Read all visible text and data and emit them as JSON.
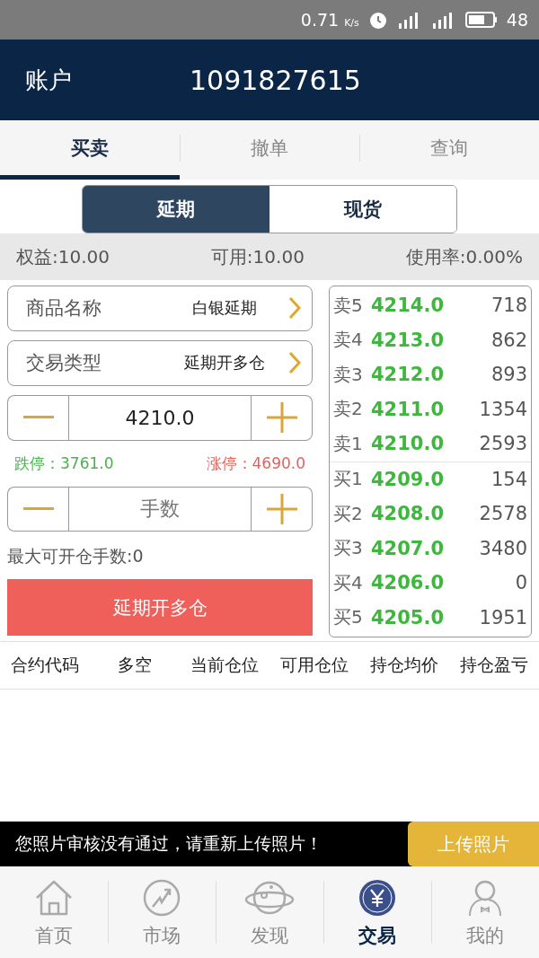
{
  "status_bar": {
    "speed": "0.71",
    "speed_unit": "K/s",
    "battery": "48"
  },
  "header": {
    "title": "账户",
    "account": "1091827615"
  },
  "tabs": [
    {
      "label": "买卖",
      "selected": true
    },
    {
      "label": "撤单",
      "selected": false
    },
    {
      "label": "查询",
      "selected": false
    }
  ],
  "segments": [
    {
      "label": "延期",
      "selected": true
    },
    {
      "label": "现货",
      "selected": false
    }
  ],
  "summary": [
    "权益:10.00",
    "可用:10.00",
    "使用率:0.00%"
  ],
  "form": {
    "product": {
      "label": "商品名称",
      "value": "白银延期"
    },
    "trade_type": {
      "label": "交易类型",
      "value": "延期开多仓"
    },
    "price": {
      "value": "4210.0"
    },
    "limit_down": "跌停：3761.0",
    "limit_up": "涨停：4690.0",
    "lots": {
      "placeholder": "手数"
    },
    "max_lots": "最大可开仓手数:0",
    "submit": "延期开多仓"
  },
  "order_book": {
    "asks": [
      {
        "label": "卖5",
        "price": "4214.0",
        "volume": "718"
      },
      {
        "label": "卖4",
        "price": "4213.0",
        "volume": "862"
      },
      {
        "label": "卖3",
        "price": "4212.0",
        "volume": "893"
      },
      {
        "label": "卖2",
        "price": "4211.0",
        "volume": "1354"
      },
      {
        "label": "卖1",
        "price": "4210.0",
        "volume": "2593"
      }
    ],
    "bids": [
      {
        "label": "买1",
        "price": "4209.0",
        "volume": "154"
      },
      {
        "label": "买2",
        "price": "4208.0",
        "volume": "2578"
      },
      {
        "label": "买3",
        "price": "4207.0",
        "volume": "3480"
      },
      {
        "label": "买4",
        "price": "4206.0",
        "volume": "0"
      },
      {
        "label": "买5",
        "price": "4205.0",
        "volume": "1951"
      }
    ]
  },
  "positions_table": {
    "columns": [
      "合约代码",
      "多空",
      "当前仓位",
      "可用仓位",
      "持仓均价",
      "持仓盈亏"
    ]
  },
  "banner": {
    "message": "您照片审核没有通过，请重新上传照片！",
    "button": "上传照片"
  },
  "bottom_nav": [
    {
      "label": "首页",
      "selected": false
    },
    {
      "label": "市场",
      "selected": false
    },
    {
      "label": "发现",
      "selected": false
    },
    {
      "label": "交易",
      "selected": true
    },
    {
      "label": "我的",
      "selected": false
    }
  ]
}
